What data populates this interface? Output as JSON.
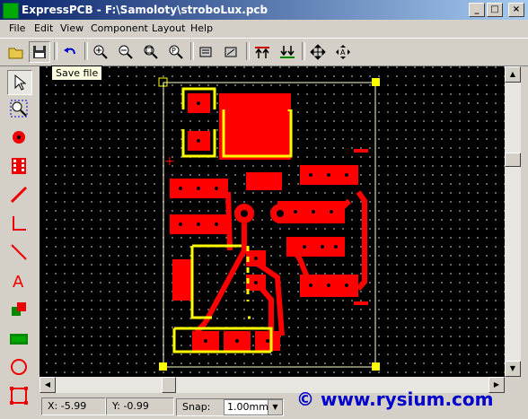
{
  "window": {
    "title": "ExpressPCB - F:\\Samoloty\\stroboLux.pcb",
    "minimize": "_",
    "maximize": "□",
    "close": "×"
  },
  "menu": [
    "File",
    "Edit",
    "View",
    "Component",
    "Layout",
    "Help"
  ],
  "toolbar": {
    "tooltip": "Save file",
    "buttons": [
      "open-file",
      "save-file",
      "undo",
      "zoom-in",
      "zoom-out",
      "zoom-fit",
      "zoom-previous",
      "component-properties",
      "pad-properties",
      "view-top-layer",
      "view-bottom-layer",
      "move-mode",
      "rotate-mode"
    ]
  },
  "tools": [
    "pointer",
    "zoom-window",
    "pad",
    "component",
    "trace",
    "dimension",
    "wire",
    "text",
    "layer-swap",
    "filled-plane",
    "circle",
    "board-outline"
  ],
  "status": {
    "x": "X: -5.99",
    "y": "Y: -0.99",
    "snap_label": "Snap:",
    "snap_value": "1.00mm"
  },
  "watermark": "© www.rysium.com",
  "colors": {
    "copper": "#ff0000",
    "silkscreen": "#ffff00",
    "outline": "#ffffcc",
    "background": "#000000",
    "title_bar": "#0a246a"
  }
}
